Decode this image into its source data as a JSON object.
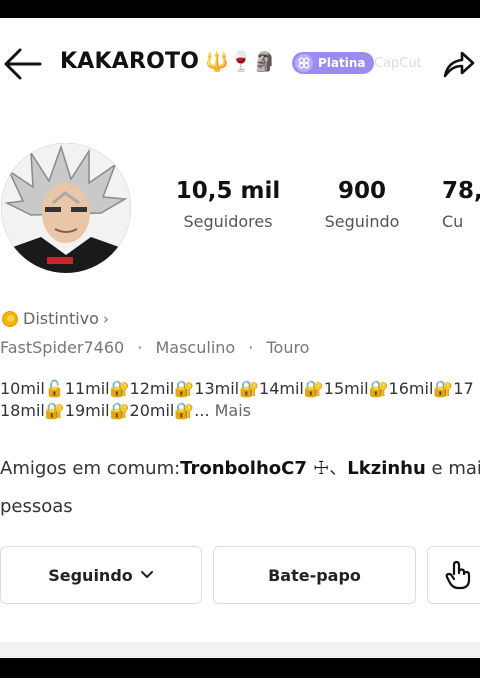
{
  "header": {
    "username": "KAKAROTO",
    "emojis": "🔱🍷🗿",
    "level_badge": "Platina",
    "watermark": "CapCut"
  },
  "stats": [
    {
      "value": "10,5 mil",
      "label": "Seguidores"
    },
    {
      "value": "900",
      "label": "Seguindo"
    },
    {
      "value": "78,",
      "label": "Cu"
    }
  ],
  "profile": {
    "badge_label": "Distintivo",
    "username_handle": "FastSpider7460",
    "gender": "Masculino",
    "sign": "Touro",
    "info_sep": "·"
  },
  "bio": {
    "line1": "10mil🔓11mil🔐12mil🔐13mil🔐14mil🔐15mil🔐16mil🔐17",
    "line2": "18mil🔐19mil🔐20mil🔐...",
    "more_label": "Mais"
  },
  "mutual_friends": {
    "prefix": "Amigos em comum:",
    "friend1": "TronbolhoC7 ☩",
    "separator": "、",
    "friend2": "Lkzinhu",
    "suffix": " e mais",
    "line2": "pessoas"
  },
  "actions": {
    "following_label": "Seguindo",
    "chat_label": "Bate-papo"
  },
  "icons": [
    "back-arrow-icon",
    "share-icon",
    "platinum-badge-icon",
    "coin-icon",
    "chevron-right-icon",
    "chevron-down-icon",
    "tap-hand-icon"
  ],
  "colors": {
    "badge_bg": "#9c8cf2",
    "coin": "#f5b400",
    "text_primary": "#111111",
    "text_secondary": "#666666"
  }
}
